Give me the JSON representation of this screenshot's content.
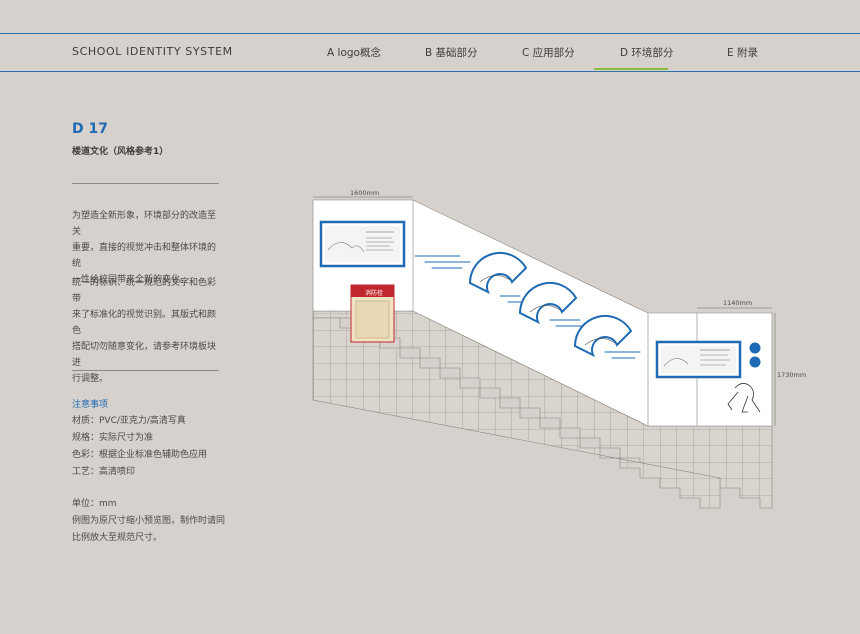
{
  "header": {
    "brand": "SCHOOL IDENTITY SYSTEM",
    "nav": [
      {
        "label": "A logo概念"
      },
      {
        "label": "B 基础部分"
      },
      {
        "label": "C 应用部分"
      },
      {
        "label": "D 环境部分",
        "active": true
      },
      {
        "label": "E 附录"
      }
    ],
    "line_color": "#2f6fb0",
    "active_color": "#8dbb3a"
  },
  "page": {
    "code": "D 17",
    "subtitle": "楼道文化（风格参考1）",
    "accent_color": "#1e6ab4",
    "paragraph1": [
      "为塑造全新形象，环境部分的改造至关",
      "重要，直接的视觉冲击和整体环境的统",
      "一性给校园带来全新的变化。"
    ],
    "paragraph2": [
      "统一的标识、统一规范的文字和色彩带",
      "来了标准化的视觉识别。其版式和颜色",
      "搭配切勿随意变化，请参考环境板块进",
      "行调整。"
    ],
    "notes_title": "注意事项",
    "notes": [
      "材质：PVC/亚克力/高清写真",
      "规格：实际尺寸为准",
      "色彩：根据企业标准色辅助色应用",
      "工艺：高清喷印"
    ],
    "unit": "单位：mm",
    "unit_note": [
      "例图为原尺寸缩小预览图，制作时请同",
      "比例放大至规范尺寸。"
    ]
  },
  "illustration": {
    "dim_width_left": "1600mm",
    "dim_width_right": "1140mm",
    "dim_height_right": "1730mm",
    "fire_panel_label": "消防栓",
    "panel_color": "#1e6ab4",
    "fire_header_color": "#c0272d"
  }
}
